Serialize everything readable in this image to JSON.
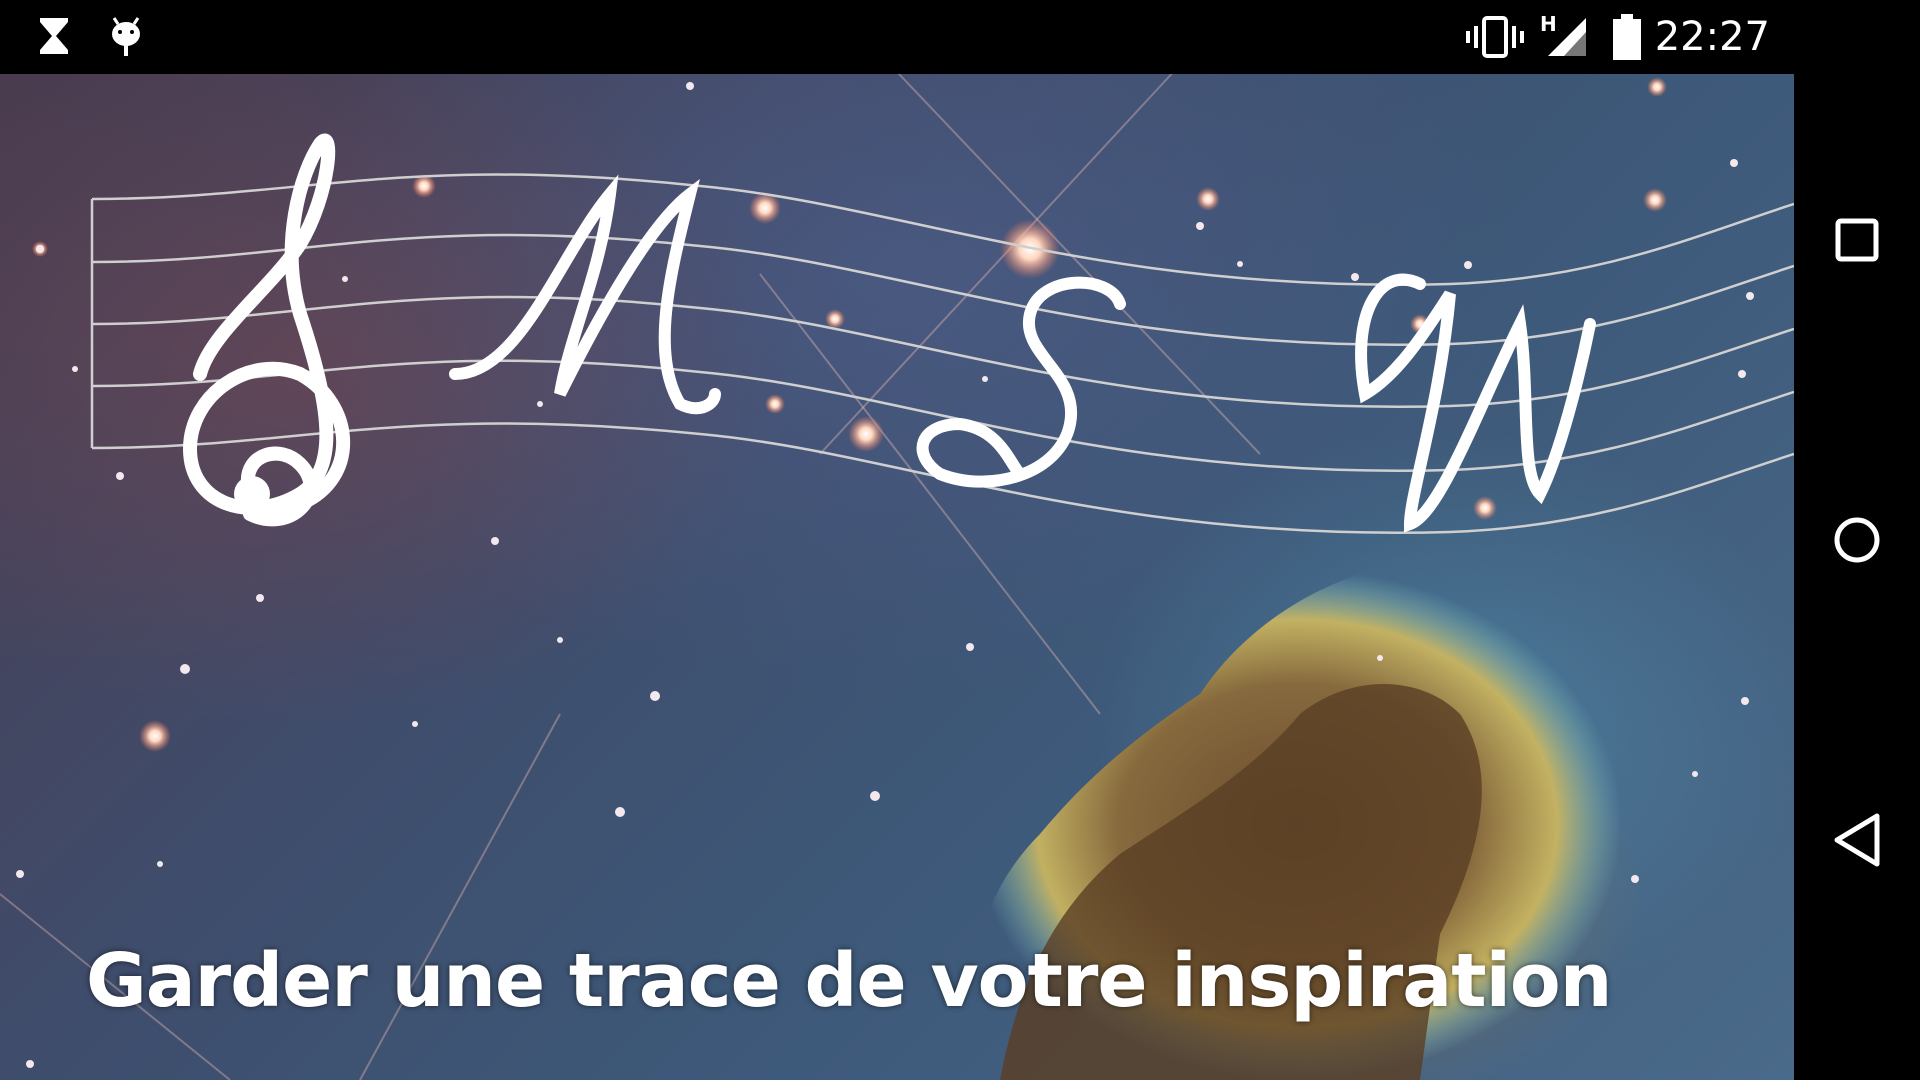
{
  "status_bar": {
    "time": "22:27",
    "network_type": "H",
    "icons": [
      "hourglass-icon",
      "android-debug-icon",
      "vibrate-icon",
      "cell-signal-icon",
      "battery-icon"
    ]
  },
  "splash": {
    "logo_letters": [
      "M",
      "S",
      "N"
    ],
    "tagline": "Garder une trace de votre inspiration"
  },
  "nav_bar": {
    "buttons": [
      "recents-button",
      "home-button",
      "back-button"
    ]
  },
  "colors": {
    "status_bar_bg": "#000000",
    "text": "#ffffff"
  }
}
